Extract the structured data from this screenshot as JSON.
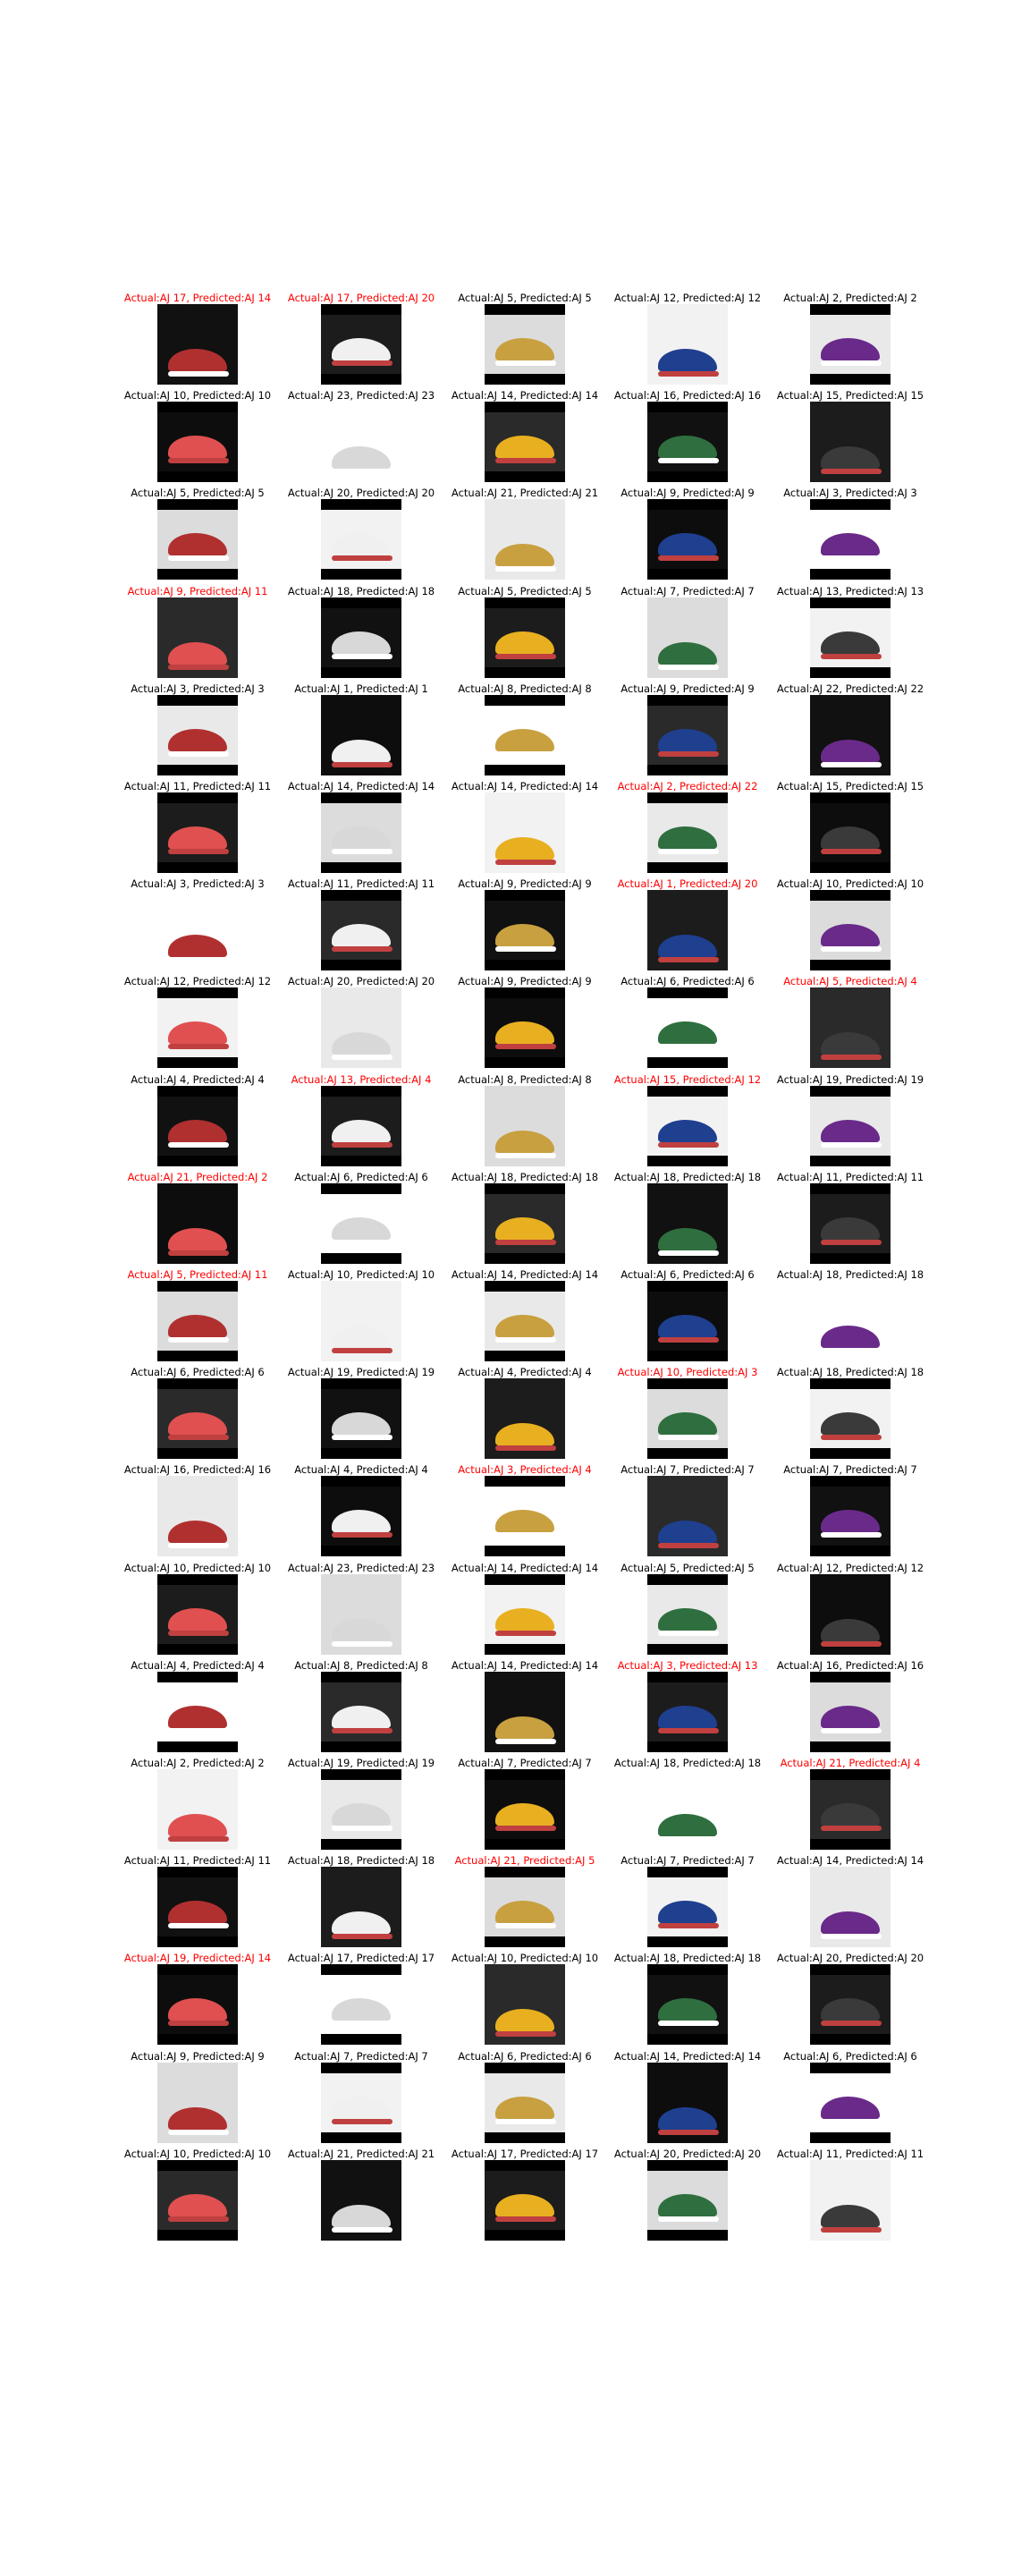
{
  "colors": {
    "correct": "#000000",
    "incorrect": "#ff0000",
    "frame": "#000000"
  },
  "rows": [
    [
      {
        "caption": "Actual:AJ 17, Predicted:AJ 14",
        "correct": false
      },
      {
        "caption": "Actual:AJ 17, Predicted:AJ 20",
        "correct": false
      },
      {
        "caption": "Actual:AJ 5, Predicted:AJ 5",
        "correct": true
      },
      {
        "caption": "Actual:AJ 12, Predicted:AJ 12",
        "correct": true
      },
      {
        "caption": "Actual:AJ 2, Predicted:AJ 2",
        "correct": true
      }
    ],
    [
      {
        "caption": "Actual:AJ 10, Predicted:AJ 10",
        "correct": true
      },
      {
        "caption": "Actual:AJ 23, Predicted:AJ 23",
        "correct": true
      },
      {
        "caption": "Actual:AJ 14, Predicted:AJ 14",
        "correct": true
      },
      {
        "caption": "Actual:AJ 16, Predicted:AJ 16",
        "correct": true
      },
      {
        "caption": "Actual:AJ 15, Predicted:AJ 15",
        "correct": true
      }
    ],
    [
      {
        "caption": "Actual:AJ 5, Predicted:AJ 5",
        "correct": true
      },
      {
        "caption": "Actual:AJ 20, Predicted:AJ 20",
        "correct": true
      },
      {
        "caption": "Actual:AJ 21, Predicted:AJ 21",
        "correct": true
      },
      {
        "caption": "Actual:AJ 9, Predicted:AJ 9",
        "correct": true
      },
      {
        "caption": "Actual:AJ 3, Predicted:AJ 3",
        "correct": true
      }
    ],
    [
      {
        "caption": "Actual:AJ 9, Predicted:AJ 11",
        "correct": false
      },
      {
        "caption": "Actual:AJ 18, Predicted:AJ 18",
        "correct": true
      },
      {
        "caption": "Actual:AJ 5, Predicted:AJ 5",
        "correct": true
      },
      {
        "caption": "Actual:AJ 7, Predicted:AJ 7",
        "correct": true
      },
      {
        "caption": "Actual:AJ 13, Predicted:AJ 13",
        "correct": true
      }
    ],
    [
      {
        "caption": "Actual:AJ 3, Predicted:AJ 3",
        "correct": true
      },
      {
        "caption": "Actual:AJ 1, Predicted:AJ 1",
        "correct": true
      },
      {
        "caption": "Actual:AJ 8, Predicted:AJ 8",
        "correct": true
      },
      {
        "caption": "Actual:AJ 9, Predicted:AJ 9",
        "correct": true
      },
      {
        "caption": "Actual:AJ 22, Predicted:AJ 22",
        "correct": true
      }
    ],
    [
      {
        "caption": "Actual:AJ 11, Predicted:AJ 11",
        "correct": true
      },
      {
        "caption": "Actual:AJ 14, Predicted:AJ 14",
        "correct": true
      },
      {
        "caption": "Actual:AJ 14, Predicted:AJ 14",
        "correct": true
      },
      {
        "caption": "Actual:AJ 2, Predicted:AJ 22",
        "correct": false
      },
      {
        "caption": "Actual:AJ 15, Predicted:AJ 15",
        "correct": true
      }
    ],
    [
      {
        "caption": "Actual:AJ 3, Predicted:AJ 3",
        "correct": true
      },
      {
        "caption": "Actual:AJ 11, Predicted:AJ 11",
        "correct": true
      },
      {
        "caption": "Actual:AJ 9, Predicted:AJ 9",
        "correct": true
      },
      {
        "caption": "Actual:AJ 1, Predicted:AJ 20",
        "correct": false
      },
      {
        "caption": "Actual:AJ 10, Predicted:AJ 10",
        "correct": true
      }
    ],
    [
      {
        "caption": "Actual:AJ 12, Predicted:AJ 12",
        "correct": true
      },
      {
        "caption": "Actual:AJ 20, Predicted:AJ 20",
        "correct": true
      },
      {
        "caption": "Actual:AJ 9, Predicted:AJ 9",
        "correct": true
      },
      {
        "caption": "Actual:AJ 6, Predicted:AJ 6",
        "correct": true
      },
      {
        "caption": "Actual:AJ 5, Predicted:AJ 4",
        "correct": false
      }
    ],
    [
      {
        "caption": "Actual:AJ 4, Predicted:AJ 4",
        "correct": true
      },
      {
        "caption": "Actual:AJ 13, Predicted:AJ 4",
        "correct": false
      },
      {
        "caption": "Actual:AJ 8, Predicted:AJ 8",
        "correct": true
      },
      {
        "caption": "Actual:AJ 15, Predicted:AJ 12",
        "correct": false
      },
      {
        "caption": "Actual:AJ 19, Predicted:AJ 19",
        "correct": true
      }
    ],
    [
      {
        "caption": "Actual:AJ 21, Predicted:AJ 2",
        "correct": false
      },
      {
        "caption": "Actual:AJ 6, Predicted:AJ 6",
        "correct": true
      },
      {
        "caption": "Actual:AJ 18, Predicted:AJ 18",
        "correct": true
      },
      {
        "caption": "Actual:AJ 18, Predicted:AJ 18",
        "correct": true
      },
      {
        "caption": "Actual:AJ 11, Predicted:AJ 11",
        "correct": true
      }
    ],
    [
      {
        "caption": "Actual:AJ 5, Predicted:AJ 11",
        "correct": false
      },
      {
        "caption": "Actual:AJ 10, Predicted:AJ 10",
        "correct": true
      },
      {
        "caption": "Actual:AJ 14, Predicted:AJ 14",
        "correct": true
      },
      {
        "caption": "Actual:AJ 6, Predicted:AJ 6",
        "correct": true
      },
      {
        "caption": "Actual:AJ 18, Predicted:AJ 18",
        "correct": true
      }
    ],
    [
      {
        "caption": "Actual:AJ 6, Predicted:AJ 6",
        "correct": true
      },
      {
        "caption": "Actual:AJ 19, Predicted:AJ 19",
        "correct": true
      },
      {
        "caption": "Actual:AJ 4, Predicted:AJ 4",
        "correct": true
      },
      {
        "caption": "Actual:AJ 10, Predicted:AJ 3",
        "correct": false
      },
      {
        "caption": "Actual:AJ 18, Predicted:AJ 18",
        "correct": true
      }
    ],
    [
      {
        "caption": "Actual:AJ 16, Predicted:AJ 16",
        "correct": true
      },
      {
        "caption": "Actual:AJ 4, Predicted:AJ 4",
        "correct": true
      },
      {
        "caption": "Actual:AJ 3, Predicted:AJ 4",
        "correct": false
      },
      {
        "caption": "Actual:AJ 7, Predicted:AJ 7",
        "correct": true
      },
      {
        "caption": "Actual:AJ 7, Predicted:AJ 7",
        "correct": true
      }
    ],
    [
      {
        "caption": "Actual:AJ 10, Predicted:AJ 10",
        "correct": true
      },
      {
        "caption": "Actual:AJ 23, Predicted:AJ 23",
        "correct": true
      },
      {
        "caption": "Actual:AJ 14, Predicted:AJ 14",
        "correct": true
      },
      {
        "caption": "Actual:AJ 5, Predicted:AJ 5",
        "correct": true
      },
      {
        "caption": "Actual:AJ 12, Predicted:AJ 12",
        "correct": true
      }
    ],
    [
      {
        "caption": "Actual:AJ 4, Predicted:AJ 4",
        "correct": true
      },
      {
        "caption": "Actual:AJ 8, Predicted:AJ 8",
        "correct": true
      },
      {
        "caption": "Actual:AJ 14, Predicted:AJ 14",
        "correct": true
      },
      {
        "caption": "Actual:AJ 3, Predicted:AJ 13",
        "correct": false
      },
      {
        "caption": "Actual:AJ 16, Predicted:AJ 16",
        "correct": true
      }
    ],
    [
      {
        "caption": "Actual:AJ 2, Predicted:AJ 2",
        "correct": true
      },
      {
        "caption": "Actual:AJ 19, Predicted:AJ 19",
        "correct": true
      },
      {
        "caption": "Actual:AJ 7, Predicted:AJ 7",
        "correct": true
      },
      {
        "caption": "Actual:AJ 18, Predicted:AJ 18",
        "correct": true
      },
      {
        "caption": "Actual:AJ 21, Predicted:AJ 4",
        "correct": false
      }
    ],
    [
      {
        "caption": "Actual:AJ 11, Predicted:AJ 11",
        "correct": true
      },
      {
        "caption": "Actual:AJ 18, Predicted:AJ 18",
        "correct": true
      },
      {
        "caption": "Actual:AJ 21, Predicted:AJ 5",
        "correct": false
      },
      {
        "caption": "Actual:AJ 7, Predicted:AJ 7",
        "correct": true
      },
      {
        "caption": "Actual:AJ 14, Predicted:AJ 14",
        "correct": true
      }
    ],
    [
      {
        "caption": "Actual:AJ 19, Predicted:AJ 14",
        "correct": false
      },
      {
        "caption": "Actual:AJ 17, Predicted:AJ 17",
        "correct": true
      },
      {
        "caption": "Actual:AJ 10, Predicted:AJ 10",
        "correct": true
      },
      {
        "caption": "Actual:AJ 18, Predicted:AJ 18",
        "correct": true
      },
      {
        "caption": "Actual:AJ 20, Predicted:AJ 20",
        "correct": true
      }
    ],
    [
      {
        "caption": "Actual:AJ 9, Predicted:AJ 9",
        "correct": true
      },
      {
        "caption": "Actual:AJ 7, Predicted:AJ 7",
        "correct": true
      },
      {
        "caption": "Actual:AJ 6, Predicted:AJ 6",
        "correct": true
      },
      {
        "caption": "Actual:AJ 14, Predicted:AJ 14",
        "correct": true
      },
      {
        "caption": "Actual:AJ 6, Predicted:AJ 6",
        "correct": true
      }
    ],
    [
      {
        "caption": "Actual:AJ 10, Predicted:AJ 10",
        "correct": true
      },
      {
        "caption": "Actual:AJ 21, Predicted:AJ 21",
        "correct": true
      },
      {
        "caption": "Actual:AJ 17, Predicted:AJ 17",
        "correct": true
      },
      {
        "caption": "Actual:AJ 20, Predicted:AJ 20",
        "correct": true
      },
      {
        "caption": "Actual:AJ 11, Predicted:AJ 11",
        "correct": true
      }
    ]
  ]
}
